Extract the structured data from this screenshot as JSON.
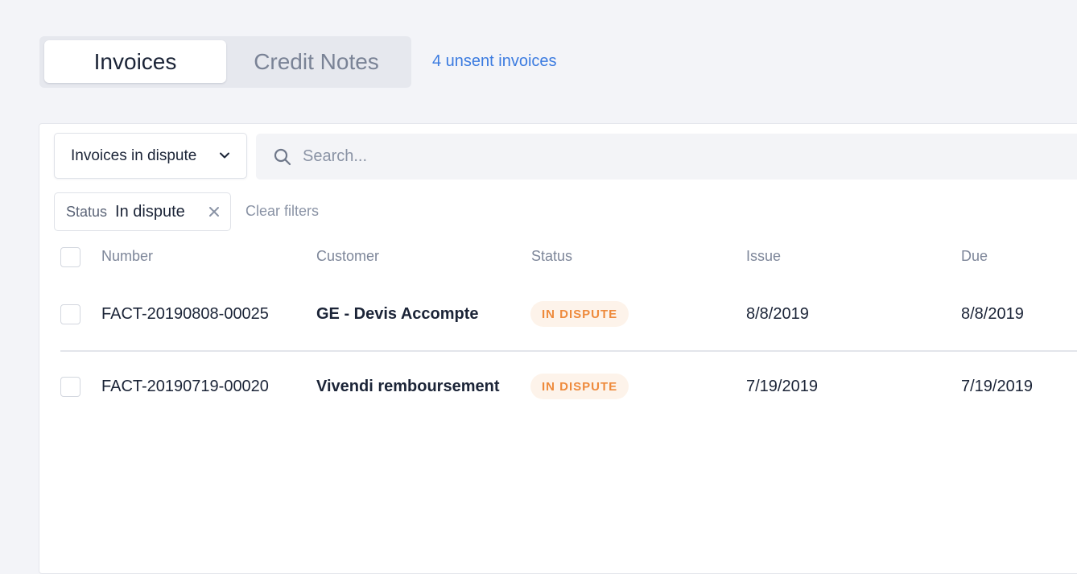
{
  "tabs": [
    {
      "label": "Invoices",
      "active": true
    },
    {
      "label": "Credit Notes",
      "active": false
    }
  ],
  "unsent_link": "4 unsent invoices",
  "view_select": {
    "value": "Invoices in dispute",
    "icon": "chevron-down-icon"
  },
  "search": {
    "placeholder": "Search...",
    "value": "",
    "icon": "search-icon"
  },
  "filter_chip": {
    "key": "Status",
    "value": "In dispute",
    "icon": "close-icon"
  },
  "clear_filters": "Clear filters",
  "table": {
    "columns": [
      "Number",
      "Customer",
      "Status",
      "Issue",
      "Due"
    ],
    "rows": [
      {
        "number": "FACT-20190808-00025",
        "customer": "GE - Devis Accompte",
        "status": "IN DISPUTE",
        "issue": "8/8/2019",
        "due": "8/8/2019"
      },
      {
        "number": "FACT-20190719-00020",
        "customer": "Vivendi remboursement",
        "status": "IN DISPUTE",
        "issue": "7/19/2019",
        "due": "7/19/2019"
      }
    ]
  },
  "colors": {
    "accent_link": "#3b7be0",
    "badge_text": "#ee8a3c",
    "badge_bg": "#fdf3ea",
    "page_bg": "#f3f4f8"
  }
}
